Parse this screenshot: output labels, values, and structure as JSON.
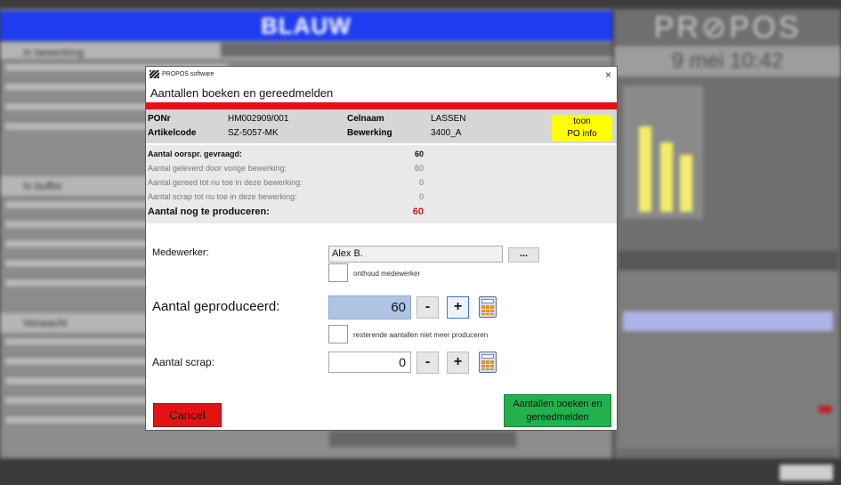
{
  "background": {
    "title": "BLAUW",
    "logo": "PR⊘POS",
    "date": "9 mei 10:42",
    "sections": [
      "In bewerking",
      "In buffer",
      "Verwacht"
    ]
  },
  "dialog": {
    "brand": "PROPOS software",
    "close_label": "×",
    "title": "Aantallen boeken en gereedmelden",
    "info": {
      "ponr_label": "PONr",
      "ponr_value": "HM002909/001",
      "artikel_label": "Artikelcode",
      "artikel_value": "SZ-5057-MK",
      "celnaam_label": "Celnaam",
      "celnaam_value": "LASSEN",
      "bewerking_label": "Bewerking",
      "bewerking_value": "3400_A",
      "toon_line1": "toon",
      "toon_line2": "PO info"
    },
    "counts": [
      {
        "label": "Aantal oorspr. gevraagd:",
        "value": "60"
      },
      {
        "label": "Aantal geleverd door vorige bewerking:",
        "value": "60"
      },
      {
        "label": "Aantal gereed tot nu toe in deze bewerking:",
        "value": "0"
      },
      {
        "label": "Aantal scrap tot nu toe in deze bewerking:",
        "value": "0"
      },
      {
        "label": "Aantal nog te produceren:",
        "value": "60"
      }
    ],
    "medewerker": {
      "label": "Medewerker:",
      "value": "Alex B.",
      "browse_label": "...",
      "remember_label": "onthoud medewerker"
    },
    "geproduceerd": {
      "label": "Aantal geproduceerd:",
      "value": "60",
      "minus": "-",
      "plus": "+",
      "no_more_label": "resterende aantallen niet meer produceren"
    },
    "scrap": {
      "label": "Aantal scrap:",
      "value": "0",
      "minus": "-",
      "plus": "+"
    },
    "cancel_label": "Cancel",
    "book_line1": "Aantallen boeken en",
    "book_line2": "gereedmelden"
  }
}
